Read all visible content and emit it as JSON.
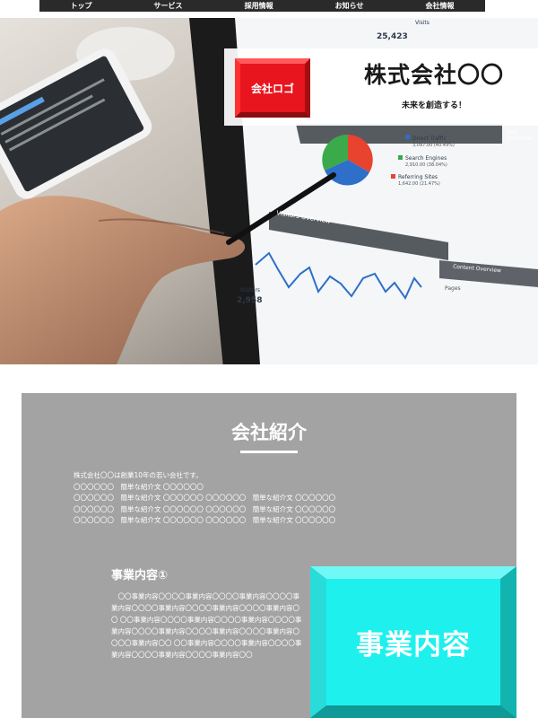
{
  "nav": {
    "items": [
      "トップ",
      "サービス",
      "採用情報",
      "お知らせ",
      "会社情報"
    ]
  },
  "hero": {
    "logo_text": "会社ロゴ",
    "company_name": "株式会社〇〇",
    "tagline": "未来を創造する！",
    "screen": {
      "visits_value": "25,423",
      "visits_label": "Visits",
      "overview_title": "Visitors Overview",
      "visitors_label": "Visitors",
      "visitors_value": "2,958",
      "legend": [
        {
          "label": "Direct Traffic",
          "value": "3,097.00 (40.49%)",
          "color": "#2e6fc9"
        },
        {
          "label": "Search Engines",
          "value": "2,910.00 (38.04%)",
          "color": "#3aaa4a"
        },
        {
          "label": "Referring Sites",
          "value": "1,642.00 (21.47%)",
          "color": "#e8432f"
        }
      ],
      "content_overview": "Content Overview",
      "map_overview": "Map Overview",
      "pages_label": "Pages"
    },
    "colors": {
      "logo_red": "#e8141e",
      "pie_blue": "#2e6fc9",
      "pie_green": "#3aaa4a",
      "pie_red": "#e8432f"
    }
  },
  "about": {
    "title": "会社紹介",
    "lines": [
      "株式会社〇〇は創業10年の若い会社です。",
      "〇〇〇〇〇〇　簡単な紹介文 〇〇〇〇〇〇",
      "〇〇〇〇〇〇　簡単な紹介文 〇〇〇〇〇〇 〇〇〇〇〇〇　簡単な紹介文 〇〇〇〇〇〇",
      "〇〇〇〇〇〇　簡単な紹介文 〇〇〇〇〇〇 〇〇〇〇〇〇　簡単な紹介文 〇〇〇〇〇〇",
      "〇〇〇〇〇〇　簡単な紹介文 〇〇〇〇〇〇 〇〇〇〇〇〇　簡単な紹介文 〇〇〇〇〇〇"
    ]
  },
  "business": {
    "title": "事業内容①",
    "text": "　〇〇事業内容〇〇〇〇事業内容〇〇〇〇事業内容〇〇〇〇事業内容〇〇〇〇事業内容〇〇〇〇事業内容〇〇〇〇事業内容〇〇 〇〇事業内容〇〇〇〇事業内容〇〇〇〇事業内容〇〇〇〇事業内容〇〇〇〇事業内容〇〇〇〇事業内容〇〇〇〇事業内容〇〇〇〇事業内容〇〇 〇〇事業内容〇〇〇〇事業内容〇〇〇〇事業内容〇〇〇〇事業内容〇〇〇〇事業内容〇〇",
    "image_text": "事業内容",
    "image_color": "#1ef0ee"
  }
}
